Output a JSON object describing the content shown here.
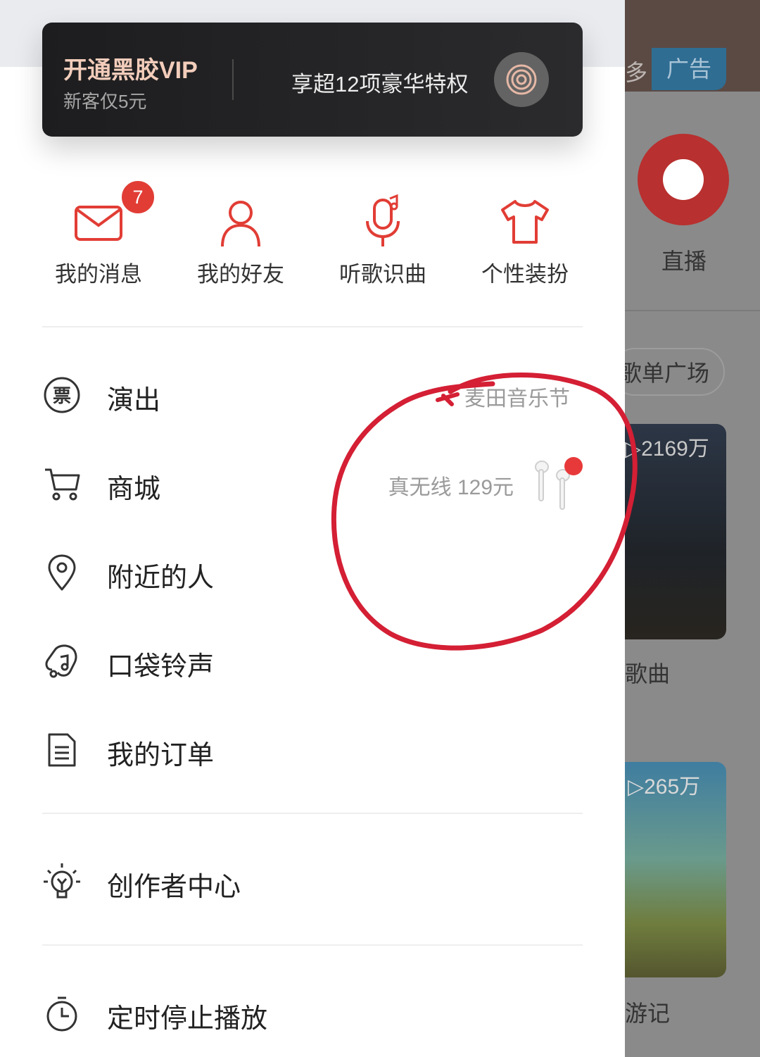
{
  "background_app": {
    "more_label": "多",
    "ad_label": "广告",
    "live_label": "直播",
    "playlist_square": "歌单广场",
    "card1_count": "▷2169万",
    "card1_label": "歌曲",
    "card2_count": "▷265万",
    "card2_label": "游记"
  },
  "vip": {
    "title": "开通黑胶VIP",
    "subtitle": "新客仅5元",
    "benefit": "享超12项豪华特权"
  },
  "quick_actions": [
    {
      "label": "我的消息",
      "badge": "7",
      "icon": "mail-icon"
    },
    {
      "label": "我的好友",
      "icon": "person-icon"
    },
    {
      "label": "听歌识曲",
      "icon": "mic-music-icon"
    },
    {
      "label": "个性装扮",
      "icon": "tshirt-icon"
    }
  ],
  "menu": [
    {
      "label": "演出",
      "right": "麦田音乐节",
      "icon": "ticket-icon"
    },
    {
      "label": "商城",
      "right": "真无线 129元",
      "icon": "cart-icon"
    },
    {
      "label": "附近的人",
      "icon": "location-pin-icon"
    },
    {
      "label": "口袋铃声",
      "icon": "ringtone-icon"
    },
    {
      "label": "我的订单",
      "icon": "order-doc-icon"
    }
  ],
  "creator": {
    "label": "创作者中心",
    "icon": "lightbulb-icon"
  },
  "timer": {
    "label": "定时停止播放",
    "icon": "timer-icon"
  },
  "colors": {
    "accent": "#e13d35",
    "annotation": "#d41f34",
    "vip_gold": "#f3cdbb"
  }
}
